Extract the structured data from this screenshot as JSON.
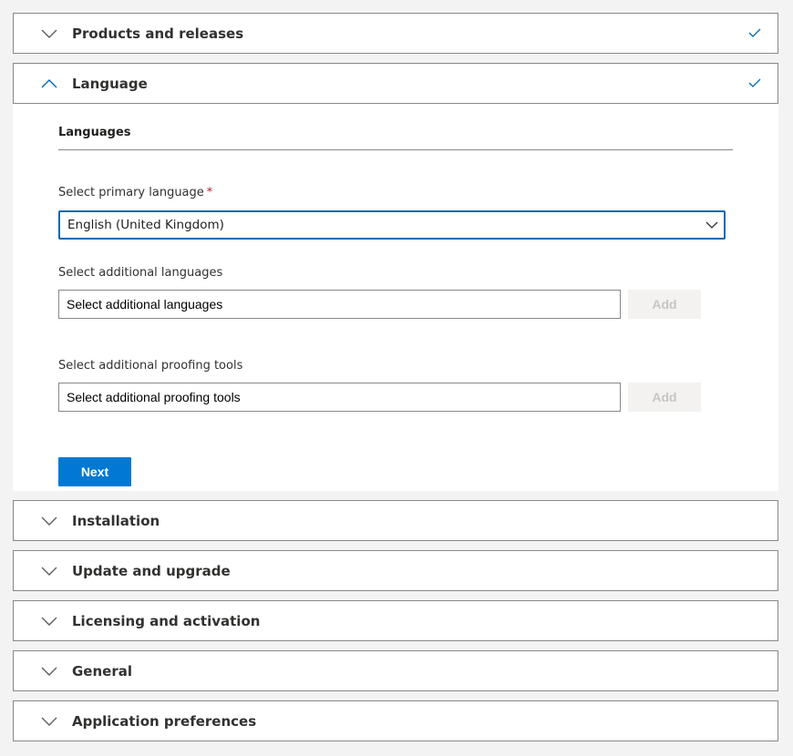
{
  "panels": {
    "products": {
      "title": "Products and releases",
      "completed": true
    },
    "language": {
      "title": "Language",
      "completed": true
    },
    "installation": {
      "title": "Installation"
    },
    "update": {
      "title": "Update and upgrade"
    },
    "licensing": {
      "title": "Licensing and activation"
    },
    "general": {
      "title": "General"
    },
    "app_prefs": {
      "title": "Application preferences"
    }
  },
  "language_section": {
    "heading": "Languages",
    "primary_label": "Select primary language",
    "required_marker": "*",
    "primary_value": "English (United Kingdom)",
    "additional_label": "Select additional languages",
    "additional_placeholder": "Select additional languages",
    "additional_add": "Add",
    "proofing_label": "Select additional proofing tools",
    "proofing_placeholder": "Select additional proofing tools",
    "proofing_add": "Add",
    "next": "Next"
  },
  "colors": {
    "accent": "#0078d4",
    "check": "#0067b8",
    "border": "#8a8886",
    "disabled_text": "#c8c6c4"
  },
  "icons": {
    "collapsed": "chevron-down-icon",
    "expanded": "chevron-up-icon",
    "done": "checkmark-icon"
  }
}
